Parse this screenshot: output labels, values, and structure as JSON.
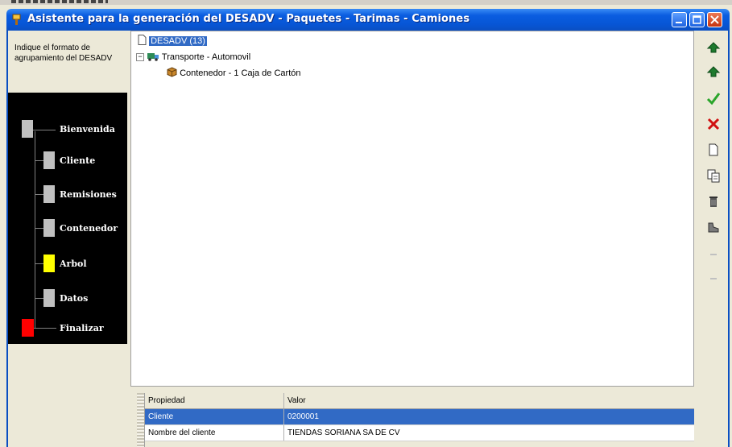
{
  "window": {
    "title": "Asistente para la generación del DESADV - Paquetes - Tarimas - Camiones"
  },
  "wizard": {
    "instruction": "Indique el formato de agrupamiento del DESADV",
    "steps": [
      {
        "label": "Bienvenida",
        "state": "done"
      },
      {
        "label": "Cliente",
        "state": "done"
      },
      {
        "label": "Remisiones",
        "state": "done"
      },
      {
        "label": "Contenedor",
        "state": "done"
      },
      {
        "label": "Arbol",
        "state": "current"
      },
      {
        "label": "Datos",
        "state": "pending"
      },
      {
        "label": "Finalizar",
        "state": "final"
      }
    ]
  },
  "tree": {
    "root": "DESADV (13)",
    "transport": "Transporte - Automovil",
    "container": "Contenedor - 1   Caja de Cartón",
    "expander": "−"
  },
  "properties": {
    "headers": [
      "Propiedad",
      "Valor"
    ],
    "rows": [
      {
        "name": "Cliente",
        "value": "0200001",
        "selected": true
      },
      {
        "name": "Nombre del cliente",
        "value": "TIENDAS SORIANA SA DE CV",
        "selected": false
      }
    ]
  },
  "toolbar": {
    "icons": [
      "move-up-icon",
      "move-down-icon",
      "accept-icon",
      "delete-icon",
      "new-document-icon",
      "copy-icon",
      "trash-icon",
      "shoe-icon",
      "arrow-up-disabled-icon",
      "arrow-down-disabled-icon"
    ]
  },
  "colors": {
    "title_bar": "#0a5de0",
    "selection": "#316ac5",
    "step_current": "#ffff00",
    "step_final": "#ff0000",
    "step_done": "#c0c0c0"
  }
}
